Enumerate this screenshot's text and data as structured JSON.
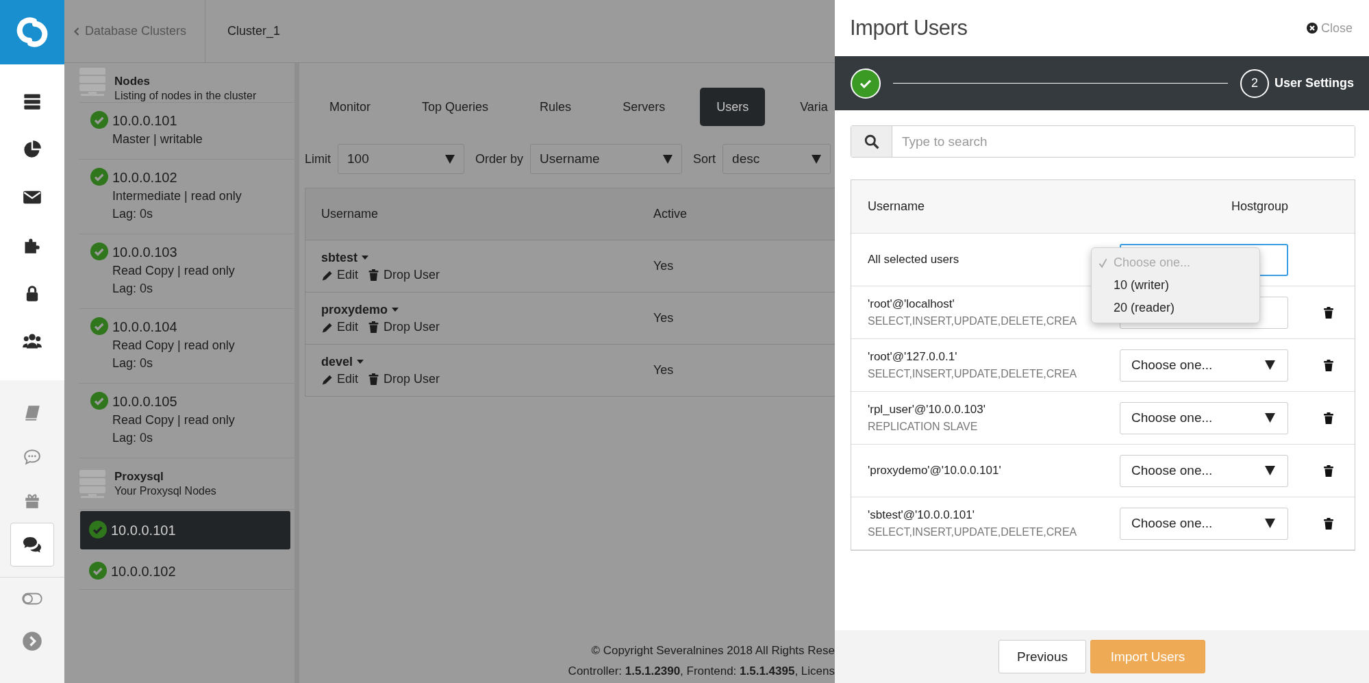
{
  "top_bar": {
    "back_link": "Database Clusters",
    "cluster": "Cluster_1"
  },
  "node_groups": [
    {
      "title": "Nodes",
      "subtitle": "Listing of nodes in the cluster",
      "nodes": [
        {
          "address": "10.0.0.101",
          "lines": [
            "Master | writable"
          ],
          "selected": false
        },
        {
          "address": "10.0.0.102",
          "lines": [
            "Intermediate | read only",
            "Lag: 0s"
          ],
          "selected": false
        },
        {
          "address": "10.0.0.103",
          "lines": [
            "Read Copy | read only",
            "Lag: 0s"
          ],
          "selected": false
        },
        {
          "address": "10.0.0.104",
          "lines": [
            "Read Copy | read only",
            "Lag: 0s"
          ],
          "selected": false
        },
        {
          "address": "10.0.0.105",
          "lines": [
            "Read Copy | read only",
            "Lag: 0s"
          ],
          "selected": false
        }
      ]
    },
    {
      "title": "Proxysql",
      "subtitle": "Your Proxysql Nodes",
      "nodes": [
        {
          "address": "10.0.0.101",
          "selected": true
        },
        {
          "address": "10.0.0.102",
          "selected": false
        }
      ]
    }
  ],
  "tabs": [
    {
      "label": "Monitor",
      "selected": false
    },
    {
      "label": "Top Queries",
      "selected": false
    },
    {
      "label": "Rules",
      "selected": false
    },
    {
      "label": "Servers",
      "selected": false
    },
    {
      "label": "Users",
      "selected": true
    },
    {
      "label": "Varia",
      "selected": false
    }
  ],
  "filters": [
    {
      "label": "Limit",
      "value": "100"
    },
    {
      "label": "Order by",
      "value": "Username"
    },
    {
      "label": "Sort",
      "value": "desc"
    }
  ],
  "users_table": {
    "columns": [
      "Username",
      "Active"
    ],
    "rows": [
      {
        "username": "sbtest",
        "active": "Yes",
        "actions": [
          {
            "kind": "edit",
            "label": "Edit"
          },
          {
            "kind": "drop",
            "label": "Drop User"
          }
        ]
      },
      {
        "username": "proxydemo",
        "active": "Yes",
        "actions": [
          {
            "kind": "edit",
            "label": "Edit"
          },
          {
            "kind": "drop",
            "label": "Drop User"
          }
        ]
      },
      {
        "username": "devel",
        "active": "Yes",
        "actions": [
          {
            "kind": "edit",
            "label": "Edit"
          },
          {
            "kind": "drop",
            "label": "Drop User"
          }
        ]
      }
    ]
  },
  "footer": {
    "copyright": "© Copyright Severalnines 2018 All Rights Rese",
    "versions": "Controller: **1.5.1.2390**, Frontend: **1.5.1.4395**, Licens"
  },
  "modal": {
    "title": "Import Users",
    "close": "Close",
    "steps": [
      {
        "kind": "done"
      },
      {
        "kind": "current",
        "number": "2",
        "label": "User Settings"
      }
    ],
    "search": {
      "placeholder": "Type to search"
    },
    "table": {
      "columns": [
        "Username",
        "Hostgroup"
      ],
      "rows": [
        {
          "user": "All selected users",
          "focused": true,
          "deletable": false
        },
        {
          "user": "'root'@'localhost'",
          "privileges": "SELECT,INSERT,UPDATE,DELETE,CREA",
          "focused": false,
          "deletable": true
        },
        {
          "user": "'root'@'127.0.0.1'",
          "privileges": "SELECT,INSERT,UPDATE,DELETE,CREA",
          "value": "Choose one...",
          "focused": false,
          "deletable": true
        },
        {
          "user": "'rpl_user'@'10.0.0.103'",
          "privileges": "REPLICATION SLAVE",
          "value": "Choose one...",
          "focused": false,
          "deletable": true
        },
        {
          "user": "'proxydemo'@'10.0.0.101'",
          "value": "Choose one...",
          "focused": false,
          "deletable": true
        },
        {
          "user": "'sbtest'@'10.0.0.101'",
          "privileges": "SELECT,INSERT,UPDATE,DELETE,CREA",
          "value": "Choose one...",
          "focused": false,
          "deletable": true
        }
      ]
    },
    "dropdown": {
      "options": [
        {
          "label": "Choose one...",
          "selected": true
        },
        {
          "label": "10 (writer)",
          "selected": false
        },
        {
          "label": "20 (reader)",
          "selected": false
        }
      ]
    },
    "buttons": [
      {
        "label": "Previous",
        "kind": "default"
      },
      {
        "label": "Import Users",
        "kind": "primary"
      }
    ]
  }
}
